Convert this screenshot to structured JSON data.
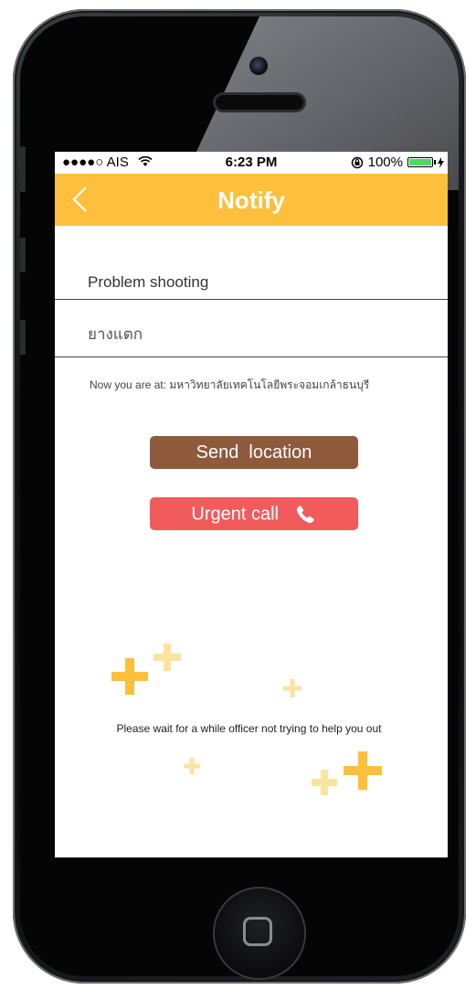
{
  "status_bar": {
    "carrier": "●●●●○ AIS",
    "time": "6:23 PM",
    "battery_text": "100%",
    "battery_level_percent": 100
  },
  "nav": {
    "title": "Notify",
    "back_icon": "chevron-left-icon"
  },
  "form": {
    "problem_label": "Problem shooting",
    "problem_value": "ยางแตก",
    "location_text": "Now you are at: มหาวิทยาลัยเทคโนโลยีพระจอมเกล้าธนบุรี"
  },
  "buttons": {
    "send_location": "Send  location",
    "urgent_call": "Urgent call"
  },
  "footer": {
    "wait_message": "Please wait for a while officer not trying to help you out"
  },
  "colors": {
    "header": "#fdbf3c",
    "send_button": "#8f5a3c",
    "urgent_button": "#f25b5c",
    "plus_strong": "#fdbf3c",
    "plus_light": "#fde3a0"
  }
}
